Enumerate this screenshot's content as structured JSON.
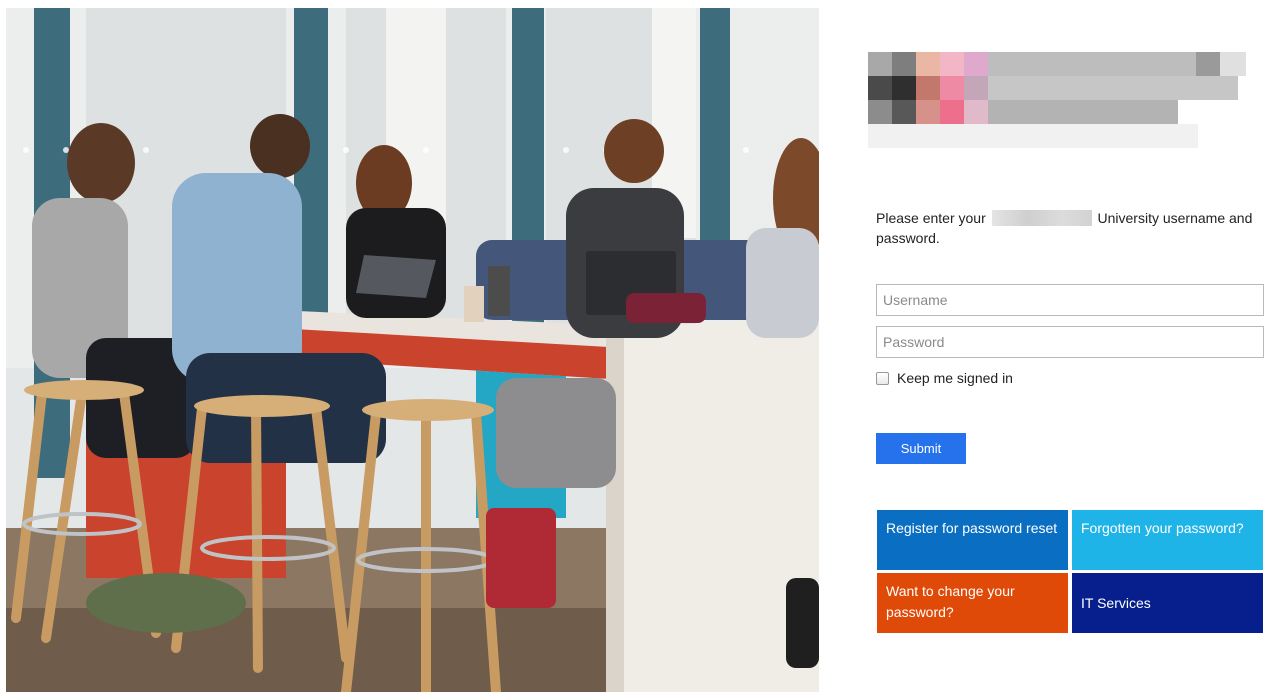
{
  "hero": {
    "alt": "Students working together at a table with laptops"
  },
  "intro": {
    "before": "Please enter your",
    "after": "University username and password."
  },
  "form": {
    "username_placeholder": "Username",
    "password_placeholder": "Password",
    "keep_signed_in_label": "Keep me signed in",
    "keep_signed_in_checked": false,
    "submit_label": "Submit"
  },
  "tiles": [
    {
      "label": "Register for password reset",
      "color": "#0a6fc2"
    },
    {
      "label": "Forgotten your password?",
      "color": "#1eb4e8"
    },
    {
      "label": "Want to change your password?",
      "color": "#df4a08"
    },
    {
      "label": "IT Services",
      "color": "#071f8c"
    }
  ],
  "colors": {
    "accent_button": "#2672ec",
    "text": "#222222"
  }
}
